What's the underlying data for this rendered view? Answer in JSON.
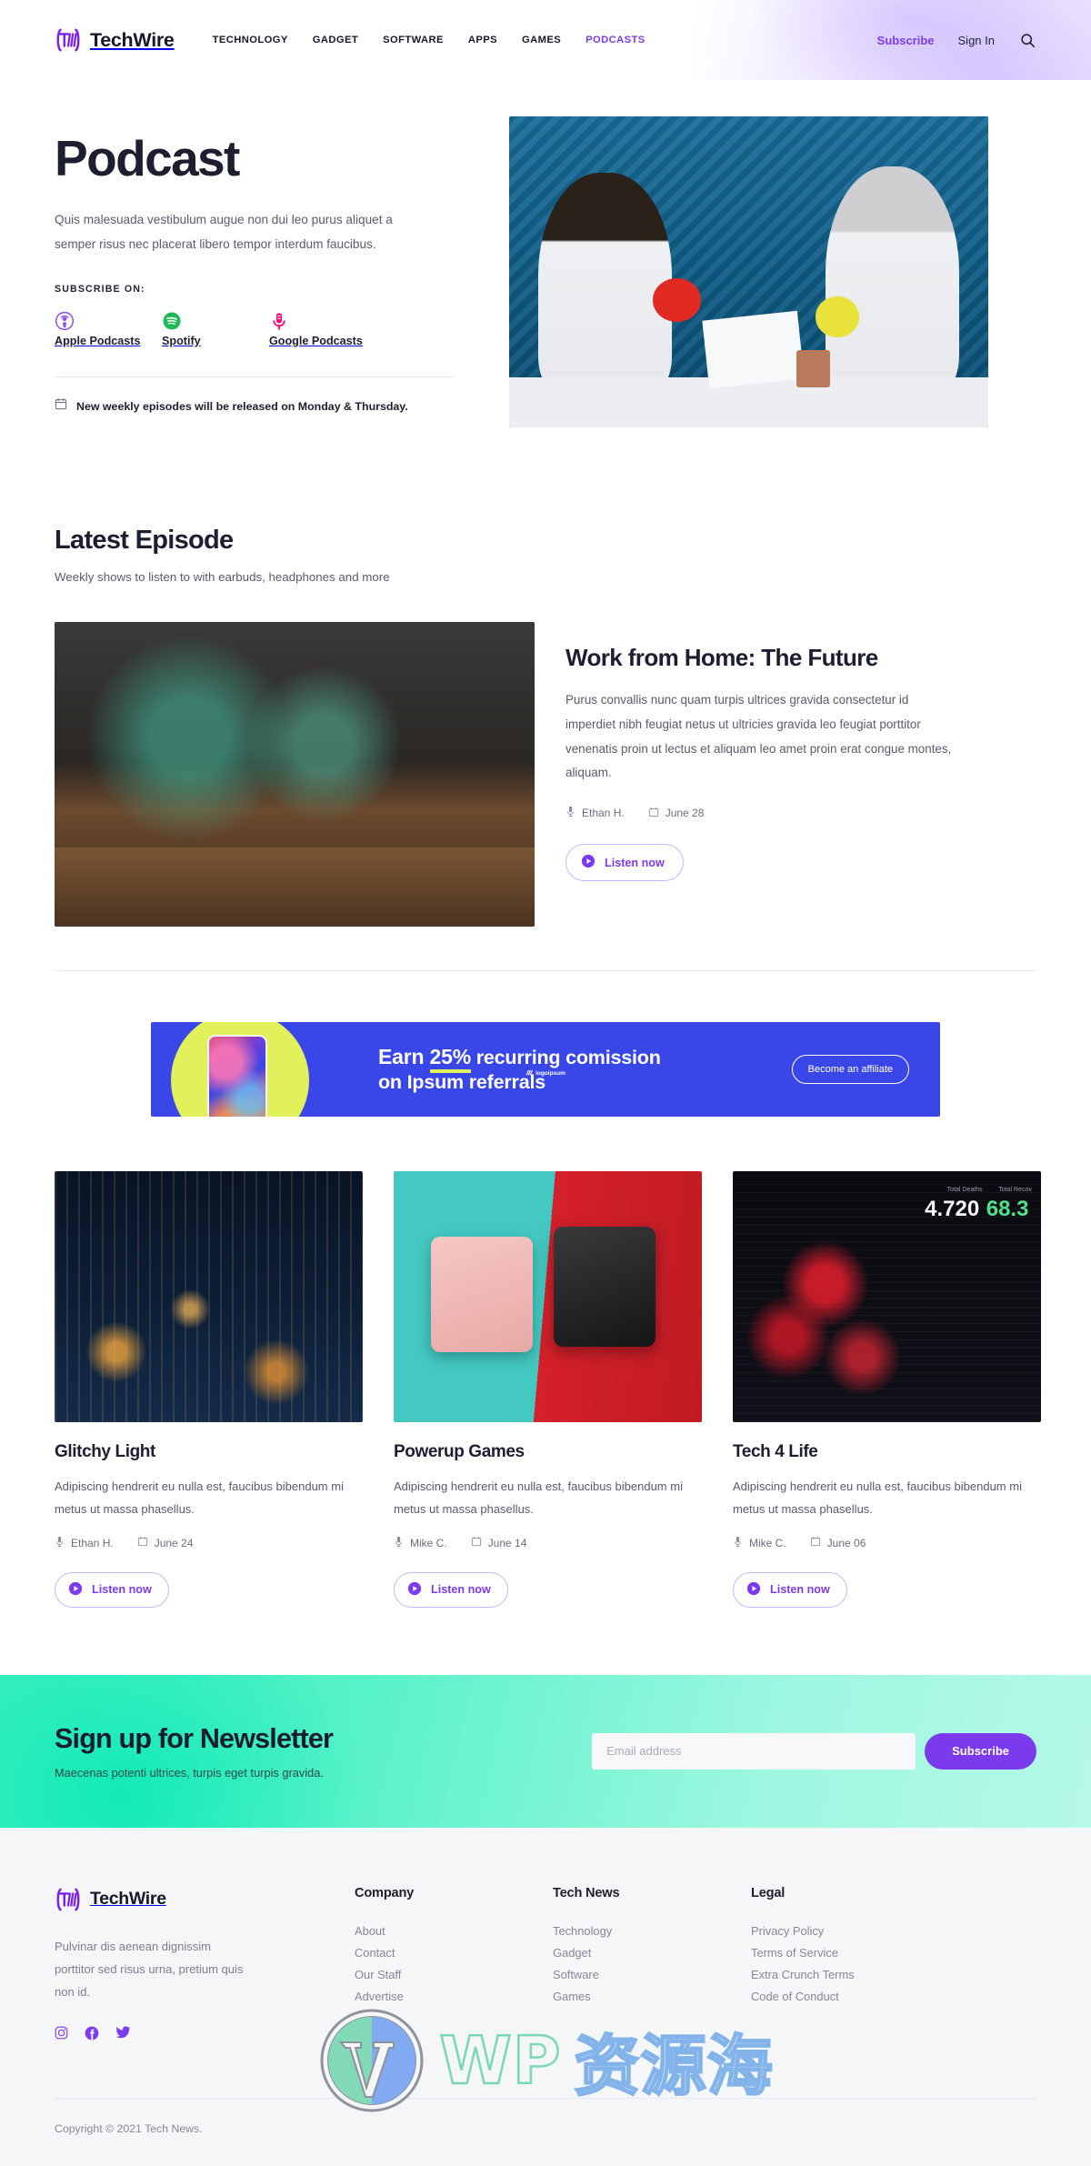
{
  "header": {
    "brand": "TechWire",
    "nav": [
      {
        "label": "TECHNOLOGY",
        "active": false
      },
      {
        "label": "GADGET",
        "active": false
      },
      {
        "label": "SOFTWARE",
        "active": false
      },
      {
        "label": "APPS",
        "active": false
      },
      {
        "label": "GAMES",
        "active": false
      },
      {
        "label": "PODCASTS",
        "active": true
      }
    ],
    "subscribe": "Subscribe",
    "signin": "Sign In",
    "search_icon": "search-icon",
    "accent": "#7c3aed"
  },
  "hero": {
    "title": "Podcast",
    "description": "Quis malesuada vestibulum augue non dui leo purus aliquet a semper risus nec placerat libero tempor interdum faucibus.",
    "subscribe_on_label": "SUBSCRIBE ON:",
    "platforms": [
      {
        "name": "Apple Podcasts",
        "icon": "apple-podcasts-icon",
        "color": "#8d4fe8"
      },
      {
        "name": "Spotify",
        "icon": "spotify-icon",
        "color": "#1db954"
      },
      {
        "name": "Google Podcasts",
        "icon": "google-podcasts-icon",
        "color": "#ef0f7d"
      }
    ],
    "schedule_icon": "calendar-icon",
    "schedule": "New weekly episodes will be released on Monday & Thursday.",
    "image_alt": "two-hosts-recording-podcast-in-studio"
  },
  "latest": {
    "title": "Latest Episode",
    "subtitle": "Weekly shows to listen to with earbuds, headphones and more",
    "featured": {
      "title": "Work from Home: The Future",
      "text": "Purus convallis nunc quam turpis ultrices gravida consectetur id imperdiet nibh feugiat netus ut ultricies gravida leo feugiat porttitor venenatis proin ut lectus et aliquam leo amet proin erat congue montes, aliquam.",
      "author": "Ethan H.",
      "date": "June 28",
      "author_icon": "microphone-icon",
      "date_icon": "calendar-icon",
      "listen_label": "Listen now",
      "play_icon": "play-circle-icon",
      "image_alt": "home-office-desk-with-monitors"
    }
  },
  "ad": {
    "line1_pre": "Earn ",
    "percent": "25%",
    "line1_post": " recurring comission",
    "line2": "on Ipsum referrals",
    "button": "Become an affiliate",
    "logo_text": "logoipsum",
    "bg": "#3a47e8",
    "accent": "#e2f05c"
  },
  "cards": [
    {
      "title": "Glitchy Light",
      "text": "Adipiscing hendrerit eu nulla est, faucibus bibendum mi metus ut massa phasellus.",
      "author": "Ethan H.",
      "date": "June 24",
      "listen_label": "Listen now",
      "image_alt": "night-city-skyline",
      "image_class": "city"
    },
    {
      "title": "Powerup Games",
      "text": "Adipiscing hendrerit eu nulla est, faucibus bibendum mi metus ut massa phasellus.",
      "author": "Mike C.",
      "date": "June 14",
      "listen_label": "Listen now",
      "image_alt": "two-handheld-game-consoles",
      "image_class": "games"
    },
    {
      "title": "Tech 4 Life",
      "text": "Adipiscing hendrerit eu nulla est, faucibus bibendum mi metus ut massa phasellus.",
      "author": "Mike C.",
      "date": "June 06",
      "listen_label": "Listen now",
      "image_alt": "data-dashboard-with-red-map",
      "image_class": "dash",
      "dash_label1": "Total Deaths",
      "dash_value1": "4.720",
      "dash_label2": "Total Recov",
      "dash_value2": "68.3"
    }
  ],
  "newsletter": {
    "title": "Sign up for Newsletter",
    "subtitle": "Maecenas potenti ultrices, turpis eget turpis gravida.",
    "placeholder": "Email address",
    "input_value": "",
    "button": "Subscribe"
  },
  "footer": {
    "brand": "TechWire",
    "about": "Pulvinar dis aenean dignissim porttitor sed risus urna, pretium quis non id.",
    "social": [
      {
        "icon": "instagram-icon"
      },
      {
        "icon": "facebook-icon"
      },
      {
        "icon": "twitter-icon"
      }
    ],
    "columns": [
      {
        "head": "Company",
        "links": [
          "About",
          "Contact",
          "Our Staff",
          "Advertise"
        ]
      },
      {
        "head": "Tech News",
        "links": [
          "Technology",
          "Gadget",
          "Software",
          "Games"
        ]
      },
      {
        "head": "Legal",
        "links": [
          "Privacy Policy",
          "Terms of Service",
          "Extra Crunch Terms",
          "Code of Conduct"
        ]
      }
    ],
    "copyright": "Copyright © 2021 Tech News."
  },
  "watermark": {
    "wp": "WP",
    "cn": "资源海",
    "logo": "wordpress-logo-icon"
  }
}
